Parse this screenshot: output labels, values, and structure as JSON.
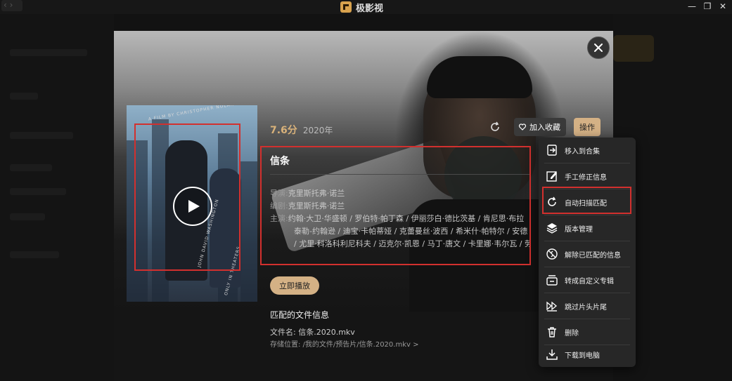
{
  "app": {
    "name": "极影视"
  },
  "titlebar": {
    "back_glyph": "‹ ›",
    "minimize": "—",
    "restore": "❐",
    "close": "✕"
  },
  "movie": {
    "rating": "7.6分",
    "year": "2020年",
    "title": "信条",
    "director_label": "导演:",
    "director": "克里斯托弗·诺兰",
    "writer_label": "编剧:",
    "writer": "克里斯托弗·诺兰",
    "cast_label": "主演:",
    "cast_line1": "约翰·大卫·华盛顿 / 罗伯特·帕丁森 / 伊丽莎白·德比茨基 / 肯尼思·布拉",
    "cast_line2": "泰勒-约翰逊 / 迪宝·卡帕蒂娅 / 克蕾曼丝·波西 / 希米什·帕特尔 / 安德",
    "cast_line3": "/ 尤里·科洛科利尼科夫 / 迈克尔·凯恩 / 马丁·唐文 / 卡里娜·韦尔瓦 / 劳"
  },
  "poster": {
    "top_text": "A FILM BY CHRISTOPHER NOLAN",
    "side_text": "JOHN DAVID WASHINGTON",
    "side_text2": "ONLY IN THEATERS"
  },
  "actions": {
    "favorite_label": "加入收藏",
    "operations_label": "操作",
    "play_now_label": "立即播放"
  },
  "file_info": {
    "heading": "匹配的文件信息",
    "file_name": "文件名: 信条.2020.mkv",
    "location": "存储位置: /我的文件/预告片/信条.2020.mkv >"
  },
  "menu": {
    "items": [
      {
        "label": "移入到合集",
        "icon": "move-to-collection-icon"
      },
      {
        "label": "手工修正信息",
        "icon": "edit-icon"
      },
      {
        "label": "自动扫描匹配",
        "icon": "refresh-icon"
      },
      {
        "label": "版本管理",
        "icon": "layers-icon"
      },
      {
        "label": "解除已匹配的信息",
        "icon": "unlink-icon"
      },
      {
        "label": "转成自定义专辑",
        "icon": "album-icon"
      },
      {
        "label": "跳过片头片尾",
        "icon": "skip-icon"
      },
      {
        "label": "删除",
        "icon": "trash-icon"
      },
      {
        "label": "下载到电脑",
        "icon": "download-icon"
      }
    ]
  },
  "colors": {
    "accent": "#d4b185",
    "highlight": "#d2302e",
    "rating": "#d9b27a"
  }
}
